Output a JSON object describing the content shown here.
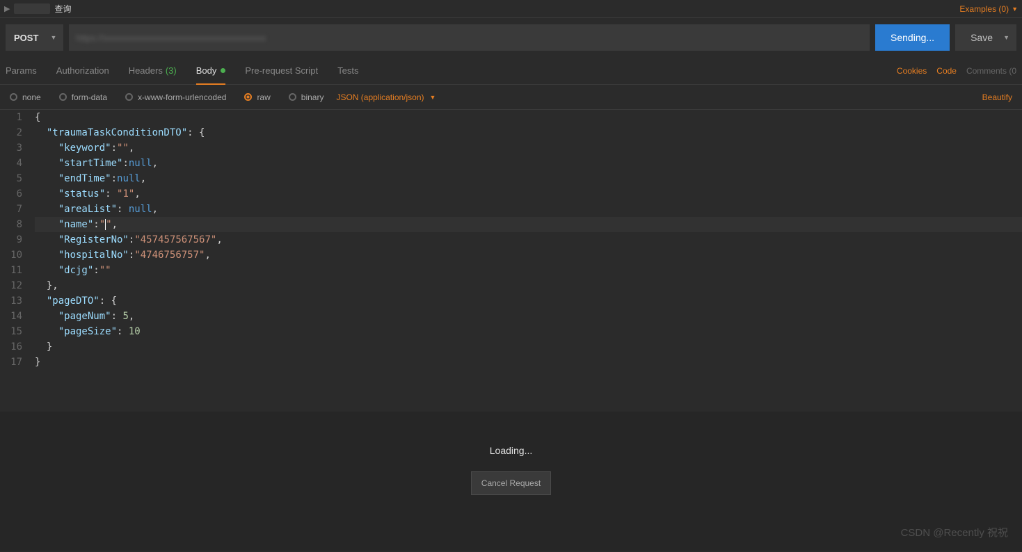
{
  "topbar": {
    "tab_title": "查询",
    "examples_label": "Examples (0)"
  },
  "request": {
    "method": "POST",
    "url_placeholder": "[redacted URL]",
    "send_label": "Sending...",
    "save_label": "Save"
  },
  "tabs": {
    "params": "Params",
    "authorization": "Authorization",
    "headers": "Headers",
    "headers_count": "(3)",
    "body": "Body",
    "prerequest": "Pre-request Script",
    "tests": "Tests"
  },
  "links": {
    "cookies": "Cookies",
    "code": "Code",
    "comments": "Comments (0"
  },
  "body_options": {
    "none": "none",
    "formdata": "form-data",
    "xwww": "x-www-form-urlencoded",
    "raw": "raw",
    "binary": "binary",
    "content_type": "JSON (application/json)",
    "beautify": "Beautify"
  },
  "editor": {
    "lines": 17,
    "code": {
      "traumaTaskConditionDTO": {
        "keyword": "",
        "startTime": null,
        "endTime": null,
        "status": "1",
        "areaList": null,
        "name": "",
        "RegisterNo": "457457567567",
        "hospitalNo": "4746756757",
        "dcjg": ""
      },
      "pageDTO": {
        "pageNum": 5,
        "pageSize": 10
      }
    }
  },
  "response": {
    "loading": "Loading...",
    "cancel": "Cancel Request"
  },
  "watermark": "CSDN @Recently 祝祝"
}
